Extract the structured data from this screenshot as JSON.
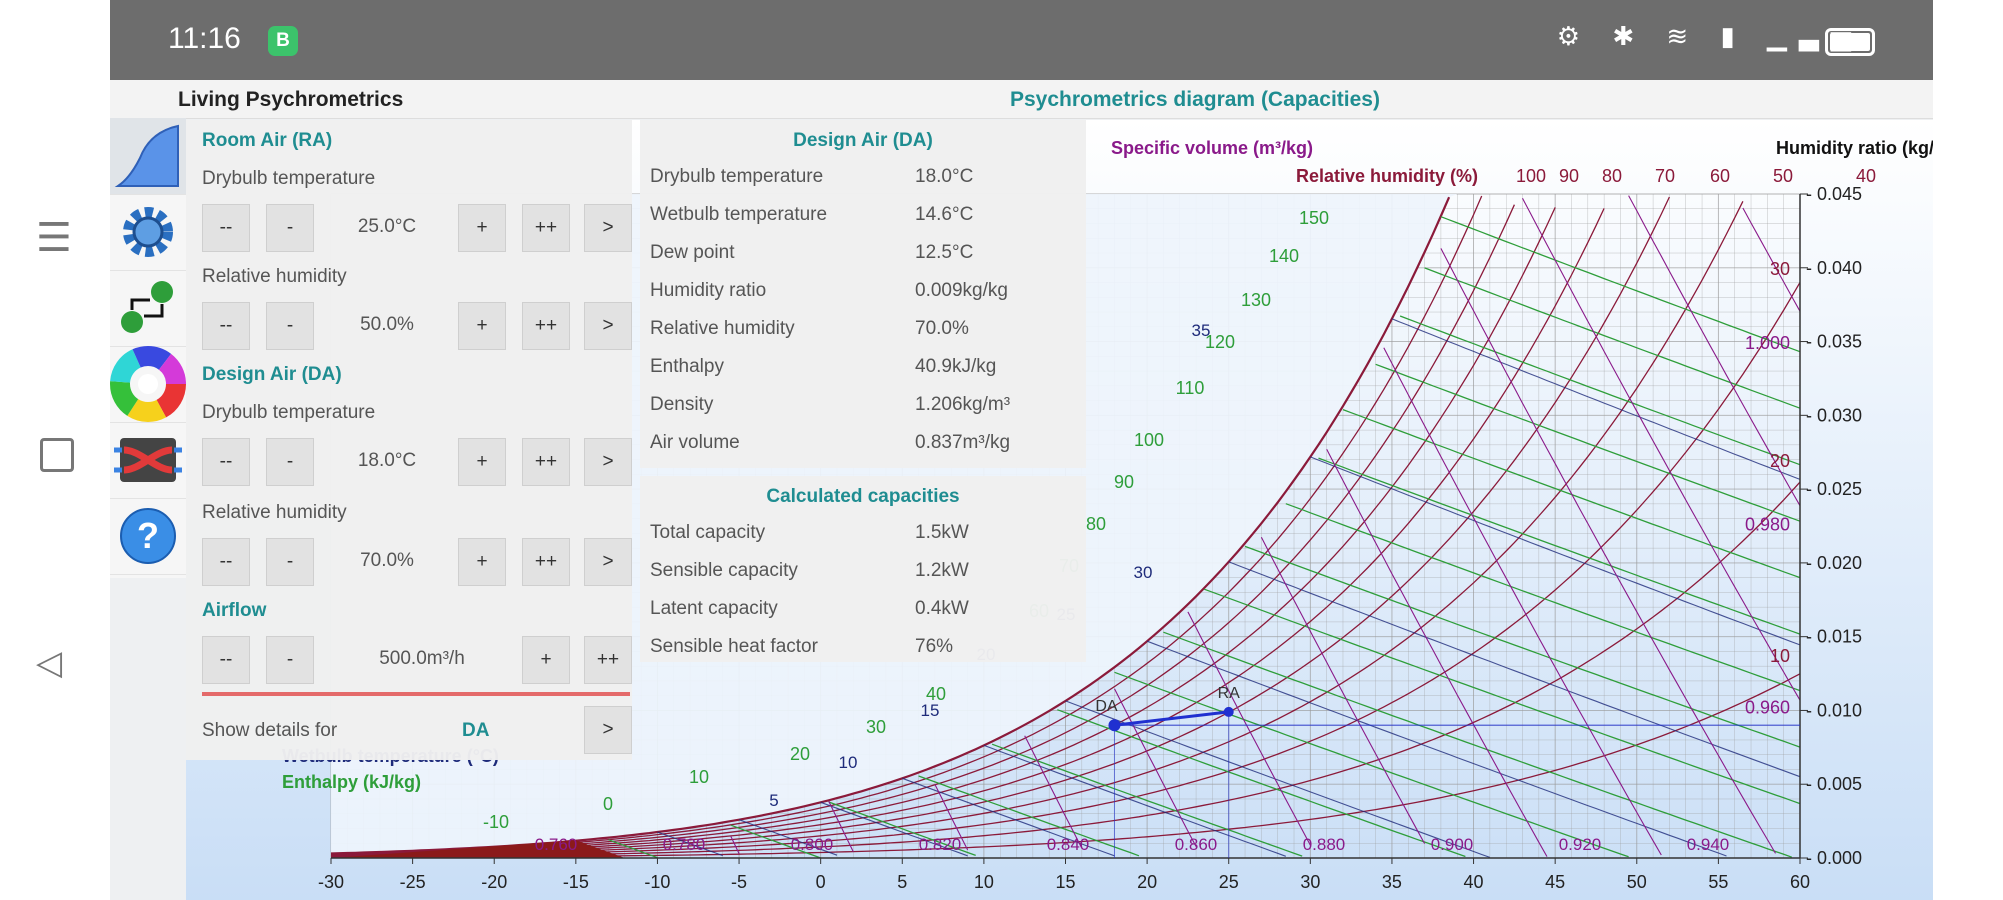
{
  "status_bar": {
    "time": "11:16",
    "notification_badge": "B"
  },
  "app": {
    "title": "Living Psychrometrics",
    "diagram_title": "Psychrometrics diagram (Capacities)"
  },
  "toolbar": [
    {
      "name": "diagram",
      "icon": "chart-icon"
    },
    {
      "name": "settings",
      "icon": "gear-icon"
    },
    {
      "name": "process",
      "icon": "process-icon"
    },
    {
      "name": "colors",
      "icon": "color-wheel-icon"
    },
    {
      "name": "exchange",
      "icon": "heat-exchanger-icon"
    },
    {
      "name": "help",
      "icon": "help-icon"
    }
  ],
  "room_air": {
    "title": "Room Air (RA)",
    "drybulb_label": "Drybulb temperature",
    "drybulb_value": "25.0°C",
    "rh_label": "Relative humidity",
    "rh_value": "50.0%"
  },
  "design_air_inputs": {
    "title": "Design Air (DA)",
    "drybulb_label": "Drybulb temperature",
    "drybulb_value": "18.0°C",
    "rh_label": "Relative humidity",
    "rh_value": "70.0%"
  },
  "airflow": {
    "title": "Airflow",
    "value": "500.0m³/h"
  },
  "stepper_buttons": {
    "minus2": "--",
    "minus": "-",
    "plus": "+",
    "plus2": "++",
    "next": ">"
  },
  "details": {
    "label": "Show details for",
    "value": "DA",
    "button": ">"
  },
  "design_air_props": {
    "title": "Design Air (DA)",
    "rows": [
      {
        "label": "Drybulb temperature",
        "value": "18.0°C"
      },
      {
        "label": "Wetbulb temperature",
        "value": "14.6°C"
      },
      {
        "label": "Dew point",
        "value": "12.5°C"
      },
      {
        "label": "Humidity ratio",
        "value": "0.009kg/kg"
      },
      {
        "label": "Relative humidity",
        "value": "70.0%"
      },
      {
        "label": "Enthalpy",
        "value": "40.9kJ/kg"
      },
      {
        "label": "Density",
        "value": "1.206kg/m³"
      },
      {
        "label": "Air volume",
        "value": "0.837m³/kg"
      }
    ]
  },
  "capacities": {
    "title": "Calculated capacities",
    "rows": [
      {
        "label": "Total capacity",
        "value": "1.5kW"
      },
      {
        "label": "Sensible capacity",
        "value": "1.2kW"
      },
      {
        "label": "Latent capacity",
        "value": "0.4kW"
      },
      {
        "label": "Sensible heat factor",
        "value": "76%"
      }
    ]
  },
  "chart_data": {
    "type": "line",
    "xlim": [
      -30,
      60
    ],
    "ylim": [
      0,
      0.045
    ],
    "x_ticks": [
      -30,
      -25,
      -20,
      -15,
      -10,
      -5,
      0,
      5,
      10,
      15,
      20,
      25,
      30,
      35,
      40,
      45,
      50,
      55,
      60
    ],
    "y_ticks": [
      "0.000",
      "0.005",
      "0.010",
      "0.015",
      "0.020",
      "0.025",
      "0.030",
      "0.035",
      "0.040",
      "0.045"
    ],
    "y_axis_label": "Humidity ratio (kg/kg)",
    "specific_volume_label": "Specific volume (m³/kg)",
    "rh_label": "Relative humidity (%)",
    "rh_top_labels": [
      "100",
      "90",
      "80",
      "70",
      "60",
      "50",
      "40"
    ],
    "rh_side_labels": [
      {
        "text": "30",
        "y": 0.0395
      },
      {
        "text": "20",
        "y": 0.0265
      },
      {
        "text": "10",
        "y": 0.0133
      }
    ],
    "volume_labels": [
      {
        "text": "1.000",
        "y": 0.0345
      },
      {
        "text": "0.980",
        "y": 0.0222
      },
      {
        "text": "0.960",
        "y": 0.0098
      }
    ],
    "volume_bottom_labels": [
      "0.760",
      "0.780",
      "0.800",
      "0.820",
      "0.840",
      "0.860",
      "0.880",
      "0.900",
      "0.920",
      "0.940"
    ],
    "wetbulb_label": "Wetbulb temperature (°C)",
    "wetbulb_labels": [
      "5",
      "10",
      "15",
      "20",
      "25",
      "30",
      "35"
    ],
    "enthalpy_label": "Enthalpy (kJ/kg)",
    "enthalpy_labels": [
      "-10",
      "0",
      "10",
      "20",
      "30",
      "40",
      "60",
      "70",
      "80",
      "90",
      "100",
      "110",
      "120",
      "130",
      "140",
      "150"
    ],
    "rh_lines": [
      100,
      90,
      80,
      70,
      60,
      50,
      40,
      30,
      20,
      10
    ],
    "points": [
      {
        "label": "DA",
        "t": 18.0,
        "w": 0.009
      },
      {
        "label": "RA",
        "t": 25.0,
        "w": 0.0099
      }
    ],
    "colors": {
      "rh": "#8b1a3a",
      "enthalpy": "#2e9e3a",
      "wetbulb": "#1e2b7a",
      "volume": "#8a1a8a",
      "grid": "#9a9a9a",
      "process": "#2030d0"
    }
  }
}
